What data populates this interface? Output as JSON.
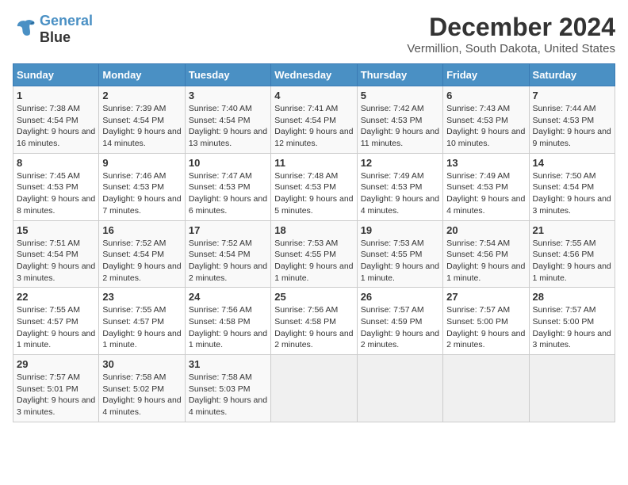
{
  "header": {
    "logo_line1": "General",
    "logo_line2": "Blue",
    "title": "December 2024",
    "subtitle": "Vermillion, South Dakota, United States"
  },
  "calendar": {
    "days_of_week": [
      "Sunday",
      "Monday",
      "Tuesday",
      "Wednesday",
      "Thursday",
      "Friday",
      "Saturday"
    ],
    "weeks": [
      [
        null,
        {
          "day": "2",
          "sunrise": "7:39 AM",
          "sunset": "4:54 PM",
          "daylight": "9 hours and 14 minutes."
        },
        {
          "day": "3",
          "sunrise": "7:40 AM",
          "sunset": "4:54 PM",
          "daylight": "9 hours and 13 minutes."
        },
        {
          "day": "4",
          "sunrise": "7:41 AM",
          "sunset": "4:54 PM",
          "daylight": "9 hours and 12 minutes."
        },
        {
          "day": "5",
          "sunrise": "7:42 AM",
          "sunset": "4:53 PM",
          "daylight": "9 hours and 11 minutes."
        },
        {
          "day": "6",
          "sunrise": "7:43 AM",
          "sunset": "4:53 PM",
          "daylight": "9 hours and 10 minutes."
        },
        {
          "day": "7",
          "sunrise": "7:44 AM",
          "sunset": "4:53 PM",
          "daylight": "9 hours and 9 minutes."
        }
      ],
      [
        {
          "day": "1",
          "sunrise": "7:38 AM",
          "sunset": "4:54 PM",
          "daylight": "9 hours and 16 minutes."
        },
        null,
        null,
        null,
        null,
        null,
        null
      ],
      [
        {
          "day": "8",
          "sunrise": "7:45 AM",
          "sunset": "4:53 PM",
          "daylight": "9 hours and 8 minutes."
        },
        {
          "day": "9",
          "sunrise": "7:46 AM",
          "sunset": "4:53 PM",
          "daylight": "9 hours and 7 minutes."
        },
        {
          "day": "10",
          "sunrise": "7:47 AM",
          "sunset": "4:53 PM",
          "daylight": "9 hours and 6 minutes."
        },
        {
          "day": "11",
          "sunrise": "7:48 AM",
          "sunset": "4:53 PM",
          "daylight": "9 hours and 5 minutes."
        },
        {
          "day": "12",
          "sunrise": "7:49 AM",
          "sunset": "4:53 PM",
          "daylight": "9 hours and 4 minutes."
        },
        {
          "day": "13",
          "sunrise": "7:49 AM",
          "sunset": "4:53 PM",
          "daylight": "9 hours and 4 minutes."
        },
        {
          "day": "14",
          "sunrise": "7:50 AM",
          "sunset": "4:54 PM",
          "daylight": "9 hours and 3 minutes."
        }
      ],
      [
        {
          "day": "15",
          "sunrise": "7:51 AM",
          "sunset": "4:54 PM",
          "daylight": "9 hours and 3 minutes."
        },
        {
          "day": "16",
          "sunrise": "7:52 AM",
          "sunset": "4:54 PM",
          "daylight": "9 hours and 2 minutes."
        },
        {
          "day": "17",
          "sunrise": "7:52 AM",
          "sunset": "4:54 PM",
          "daylight": "9 hours and 2 minutes."
        },
        {
          "day": "18",
          "sunrise": "7:53 AM",
          "sunset": "4:55 PM",
          "daylight": "9 hours and 1 minute."
        },
        {
          "day": "19",
          "sunrise": "7:53 AM",
          "sunset": "4:55 PM",
          "daylight": "9 hours and 1 minute."
        },
        {
          "day": "20",
          "sunrise": "7:54 AM",
          "sunset": "4:56 PM",
          "daylight": "9 hours and 1 minute."
        },
        {
          "day": "21",
          "sunrise": "7:55 AM",
          "sunset": "4:56 PM",
          "daylight": "9 hours and 1 minute."
        }
      ],
      [
        {
          "day": "22",
          "sunrise": "7:55 AM",
          "sunset": "4:57 PM",
          "daylight": "9 hours and 1 minute."
        },
        {
          "day": "23",
          "sunrise": "7:55 AM",
          "sunset": "4:57 PM",
          "daylight": "9 hours and 1 minute."
        },
        {
          "day": "24",
          "sunrise": "7:56 AM",
          "sunset": "4:58 PM",
          "daylight": "9 hours and 1 minute."
        },
        {
          "day": "25",
          "sunrise": "7:56 AM",
          "sunset": "4:58 PM",
          "daylight": "9 hours and 2 minutes."
        },
        {
          "day": "26",
          "sunrise": "7:57 AM",
          "sunset": "4:59 PM",
          "daylight": "9 hours and 2 minutes."
        },
        {
          "day": "27",
          "sunrise": "7:57 AM",
          "sunset": "5:00 PM",
          "daylight": "9 hours and 2 minutes."
        },
        {
          "day": "28",
          "sunrise": "7:57 AM",
          "sunset": "5:00 PM",
          "daylight": "9 hours and 3 minutes."
        }
      ],
      [
        {
          "day": "29",
          "sunrise": "7:57 AM",
          "sunset": "5:01 PM",
          "daylight": "9 hours and 3 minutes."
        },
        {
          "day": "30",
          "sunrise": "7:58 AM",
          "sunset": "5:02 PM",
          "daylight": "9 hours and 4 minutes."
        },
        {
          "day": "31",
          "sunrise": "7:58 AM",
          "sunset": "5:03 PM",
          "daylight": "9 hours and 4 minutes."
        },
        null,
        null,
        null,
        null
      ]
    ]
  }
}
